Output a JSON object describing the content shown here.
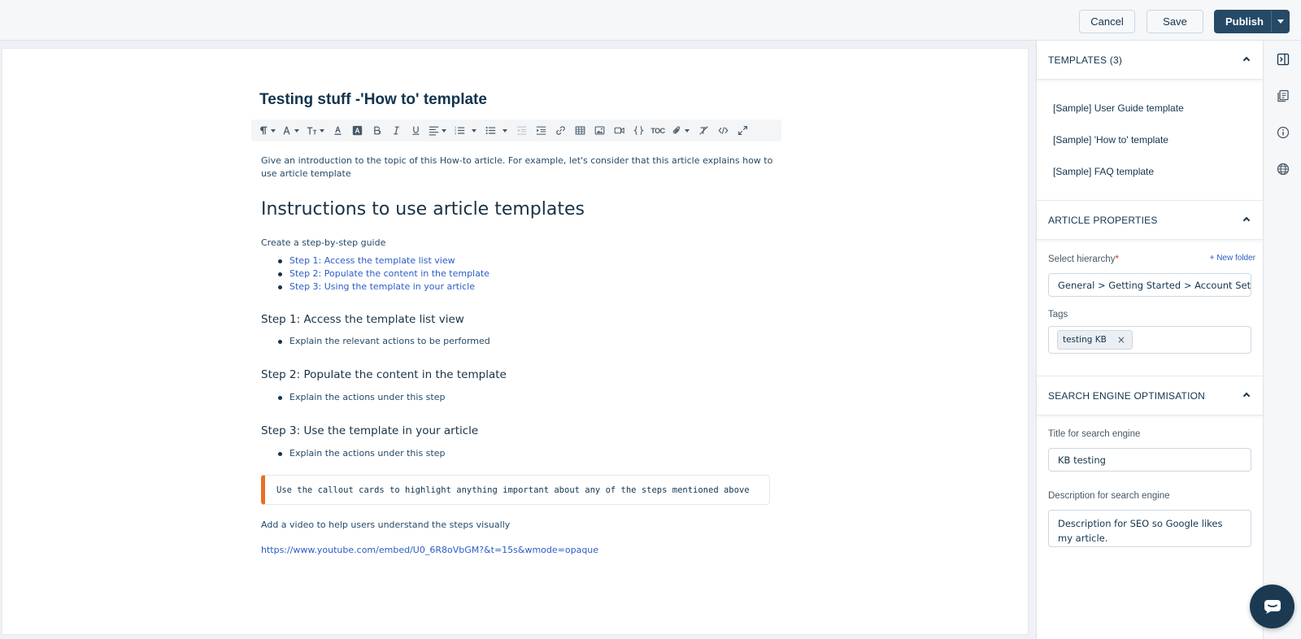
{
  "topbar": {
    "cancel_label": "Cancel",
    "save_label": "Save",
    "publish_label": "Publish"
  },
  "editor": {
    "title": "Testing stuff -'How to' template",
    "toolbar": {
      "items": [
        "paragraph-format",
        "font-family",
        "font-size",
        "text-color",
        "background-color",
        "bold",
        "italic",
        "underline",
        "align",
        "ordered-list",
        "unordered-list",
        "outdent",
        "indent",
        "insert-link",
        "insert-table",
        "insert-image",
        "insert-video",
        "code-block",
        "attachment",
        "clear-formatting",
        "code-view",
        "fullscreen"
      ],
      "toc_label": "TOC"
    },
    "intro": "Give an introduction to the topic of this How-to article. For example, let's consider that this article explains how to use article template",
    "heading": "Instructions to use article templates",
    "guide_label": "Create a step-by-step guide",
    "guide_links": [
      "Step 1: Access the template list view",
      "Step 2: Populate the content in the template",
      "Step 3: Using the template in your article"
    ],
    "steps": [
      {
        "title": "Step 1: Access the template list view",
        "bullet": "Explain the relevant actions to be performed"
      },
      {
        "title": "Step 2: Populate the content in the template",
        "bullet": "Explain the actions under this step"
      },
      {
        "title": "Step 3: Use the template in your article",
        "bullet": "Explain the actions under this step"
      }
    ],
    "callout": "Use the callout cards to highlight anything important about any of the steps mentioned above",
    "video_label": "Add a video to help users understand the steps visually",
    "video_url": "https://www.youtube.com/embed/U0_6R8oVbGM?&t=15s&wmode=opaque"
  },
  "panel": {
    "templates": {
      "header": "TEMPLATES (3)",
      "items": [
        "[Sample] User Guide template",
        "[Sample] 'How to' template",
        "[Sample] FAQ template"
      ]
    },
    "properties": {
      "header": "ARTICLE PROPERTIES",
      "hierarchy_label": "Select hierarchy",
      "required_mark": "*",
      "new_folder": "+ New folder",
      "hierarchy_value": "General > Getting Started > Account Settings",
      "tags_label": "Tags",
      "tag": "testing KB",
      "tag_remove": "×"
    },
    "seo": {
      "header": "SEARCH ENGINE OPTIMISATION",
      "title_label": "Title for search engine",
      "title_value": "KB testing",
      "description_label": "Description for search engine",
      "description_value": "Description for SEO so Google likes my article."
    }
  },
  "colors": {
    "publish": "#264966",
    "link": "#2c5cc5",
    "callout_accent": "#e86f25",
    "chat": "#1b3a52"
  }
}
